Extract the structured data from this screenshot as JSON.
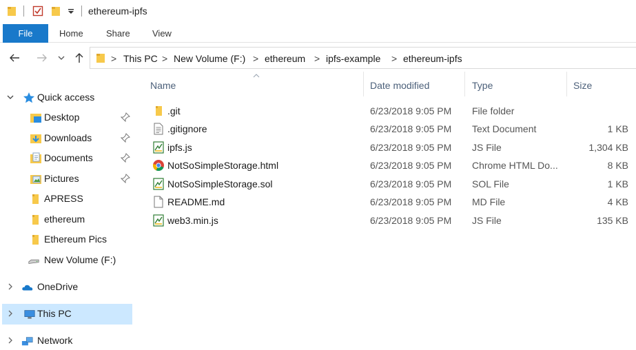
{
  "window": {
    "title": "ethereum-ipfs"
  },
  "ribbon": {
    "tabs": [
      "File",
      "Home",
      "Share",
      "View"
    ]
  },
  "nav": {
    "breadcrumb": [
      "This PC",
      "New Volume (F:)",
      "ethereum",
      "ipfs-example",
      "ethereum-ipfs"
    ],
    "separator": ">"
  },
  "sidebar": {
    "items": [
      {
        "label": "Quick access",
        "icon": "star-icon"
      },
      {
        "label": "Desktop",
        "icon": "desktop-folder-icon",
        "pinned": true
      },
      {
        "label": "Downloads",
        "icon": "downloads-folder-icon",
        "pinned": true
      },
      {
        "label": "Documents",
        "icon": "documents-folder-icon",
        "pinned": true
      },
      {
        "label": "Pictures",
        "icon": "pictures-folder-icon",
        "pinned": true
      },
      {
        "label": "APRESS",
        "icon": "folder-icon"
      },
      {
        "label": "ethereum",
        "icon": "folder-icon"
      },
      {
        "label": "Ethereum Pics",
        "icon": "folder-icon"
      },
      {
        "label": "New Volume (F:)",
        "icon": "drive-icon"
      },
      {
        "label": "OneDrive",
        "icon": "cloud-icon"
      },
      {
        "label": "This PC",
        "icon": "computer-icon",
        "selected": true
      },
      {
        "label": "Network",
        "icon": "network-icon"
      }
    ]
  },
  "list": {
    "columns": {
      "name": "Name",
      "date": "Date modified",
      "type": "Type",
      "size": "Size"
    },
    "sorted_by": "Name",
    "rows": [
      {
        "name": ".git",
        "date": "6/23/2018 9:05 PM",
        "type": "File folder",
        "size": "",
        "icon": "folder-icon"
      },
      {
        "name": ".gitignore",
        "date": "6/23/2018 9:05 PM",
        "type": "Text Document",
        "size": "1 KB",
        "icon": "text-file-icon"
      },
      {
        "name": "ipfs.js",
        "date": "6/23/2018 9:05 PM",
        "type": "JS File",
        "size": "1,304 KB",
        "icon": "script-file-icon"
      },
      {
        "name": "NotSoSimpleStorage.html",
        "date": "6/23/2018 9:05 PM",
        "type": "Chrome HTML Do...",
        "size": "8 KB",
        "icon": "chrome-icon"
      },
      {
        "name": "NotSoSimpleStorage.sol",
        "date": "6/23/2018 9:05 PM",
        "type": "SOL File",
        "size": "1 KB",
        "icon": "script-file-icon"
      },
      {
        "name": "README.md",
        "date": "6/23/2018 9:05 PM",
        "type": "MD File",
        "size": "4 KB",
        "icon": "blank-file-icon"
      },
      {
        "name": "web3.min.js",
        "date": "6/23/2018 9:05 PM",
        "type": "JS File",
        "size": "135 KB",
        "icon": "script-file-icon"
      }
    ]
  },
  "colors": {
    "accent": "#1979ca",
    "selection": "#cce8ff",
    "folder": "#f7c94b",
    "header_text": "#4c607a"
  }
}
